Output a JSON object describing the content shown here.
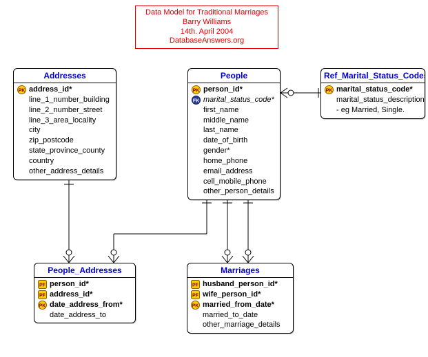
{
  "title": {
    "line1": "Data Model for Traditional Marriages",
    "line2": "Barry Williams",
    "line3": "14th. April 2004",
    "line4": "DatabaseAnswers.org"
  },
  "entities": {
    "addresses": {
      "name": "Addresses",
      "attrs": [
        {
          "icon": "pk",
          "label": "address_id*",
          "key": true
        },
        {
          "icon": "",
          "label": "line_1_number_building"
        },
        {
          "icon": "",
          "label": "line_2_number_street"
        },
        {
          "icon": "",
          "label": "line_3_area_locality"
        },
        {
          "icon": "",
          "label": "city"
        },
        {
          "icon": "",
          "label": "zip_postcode"
        },
        {
          "icon": "",
          "label": "state_province_county"
        },
        {
          "icon": "",
          "label": "country"
        },
        {
          "icon": "",
          "label": "other_address_details"
        }
      ]
    },
    "people": {
      "name": "People",
      "attrs": [
        {
          "icon": "pk",
          "label": "person_id*",
          "key": true
        },
        {
          "icon": "fk",
          "label": "marital_status_code*",
          "fk": true
        },
        {
          "icon": "",
          "label": "first_name"
        },
        {
          "icon": "",
          "label": "middle_name"
        },
        {
          "icon": "",
          "label": "last_name"
        },
        {
          "icon": "",
          "label": "date_of_birth"
        },
        {
          "icon": "",
          "label": "gender*"
        },
        {
          "icon": "",
          "label": "home_phone"
        },
        {
          "icon": "",
          "label": "email_address"
        },
        {
          "icon": "",
          "label": "cell_mobile_phone"
        },
        {
          "icon": "",
          "label": "other_person_details"
        }
      ]
    },
    "ref_marital": {
      "name": "Ref_Marital_Status_Codes",
      "attrs": [
        {
          "icon": "pk",
          "label": "marital_status_code*",
          "key": true
        },
        {
          "icon": "",
          "label": "marital_status_description"
        },
        {
          "icon": "",
          "label": "- eg Married, Single."
        }
      ]
    },
    "people_addresses": {
      "name": "People_Addresses",
      "attrs": [
        {
          "icon": "pf",
          "label": "person_id*",
          "key": true
        },
        {
          "icon": "pf",
          "label": "address_id*",
          "key": true
        },
        {
          "icon": "pk",
          "label": "date_address_from*",
          "key": true
        },
        {
          "icon": "",
          "label": "date_address_to"
        }
      ]
    },
    "marriages": {
      "name": "Marriages",
      "attrs": [
        {
          "icon": "pf",
          "label": "husband_person_id*",
          "key": true
        },
        {
          "icon": "pf",
          "label": "wife_person_id*",
          "key": true
        },
        {
          "icon": "pk",
          "label": "married_from_date*",
          "key": true
        },
        {
          "icon": "",
          "label": "married_to_date"
        },
        {
          "icon": "",
          "label": "other_marriage_details"
        }
      ]
    }
  }
}
